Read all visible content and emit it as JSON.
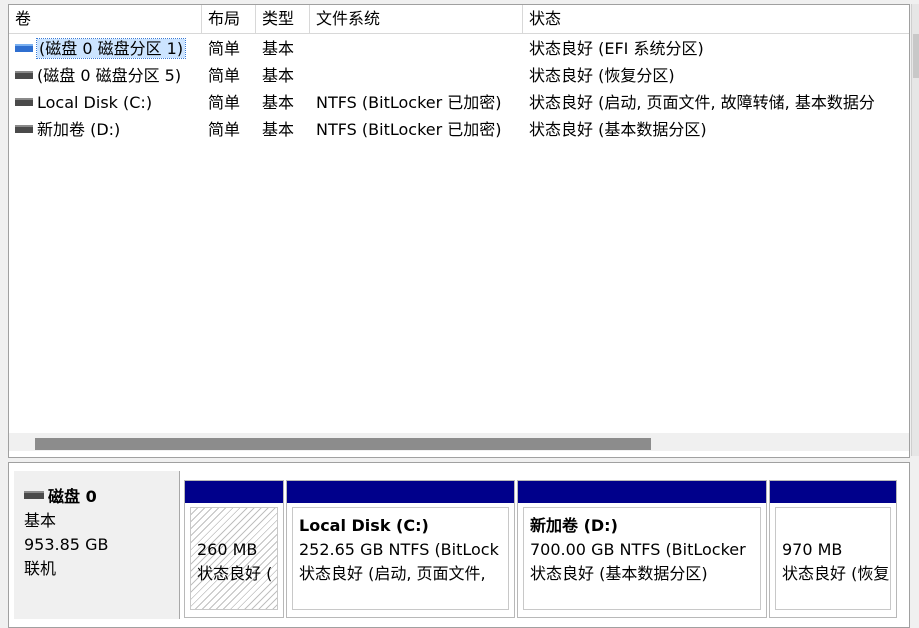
{
  "columns": [
    "卷",
    "布局",
    "类型",
    "文件系统",
    "状态"
  ],
  "volumes": [
    {
      "name": "(磁盘 0 磁盘分区 1)",
      "layout": "简单",
      "type": "基本",
      "fs": "",
      "status": "状态良好 (EFI 系统分区)",
      "icon": "blue-volume-icon"
    },
    {
      "name": "(磁盘 0 磁盘分区 5)",
      "layout": "简单",
      "type": "基本",
      "fs": "",
      "status": "状态良好 (恢复分区)",
      "icon": "volume-icon"
    },
    {
      "name": "Local Disk (C:)",
      "layout": "简单",
      "type": "基本",
      "fs": "NTFS (BitLocker 已加密)",
      "status": "状态良好 (启动, 页面文件, 故障转储, 基本数据分",
      "icon": "volume-icon"
    },
    {
      "name": "新加卷 (D:)",
      "layout": "简单",
      "type": "基本",
      "fs": "NTFS (BitLocker 已加密)",
      "status": "状态良好 (基本数据分区)",
      "icon": "volume-icon"
    }
  ],
  "disk": {
    "name": "磁盘 0",
    "type": "基本",
    "size": "953.85 GB",
    "state": "联机"
  },
  "partitions": [
    {
      "name": "",
      "size": "260 MB",
      "status": "状态良好 (",
      "hatched": true
    },
    {
      "name": "Local Disk  (C:)",
      "size": "252.65 GB NTFS (BitLock",
      "status": "状态良好 (启动, 页面文件,",
      "hatched": false
    },
    {
      "name": "新加卷  (D:)",
      "size": "700.00 GB NTFS (BitLocker",
      "status": "状态良好 (基本数据分区)",
      "hatched": false
    },
    {
      "name": "",
      "size": "970 MB",
      "status": "状态良好 (恢复",
      "hatched": false
    }
  ],
  "colors": {
    "partition_bar": "#00008b",
    "selection": "#cce4ff"
  }
}
